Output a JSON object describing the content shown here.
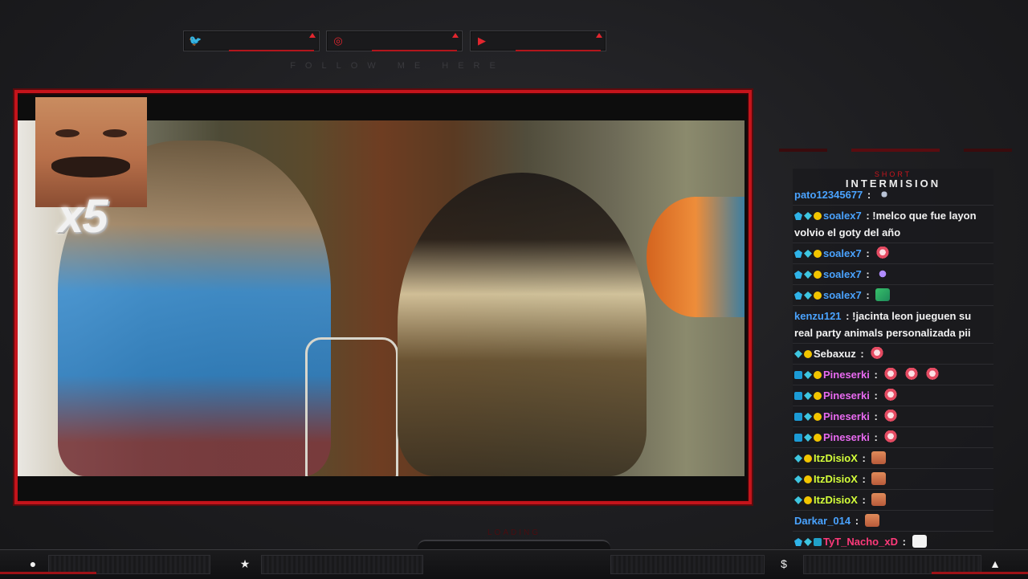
{
  "social": {
    "items": [
      {
        "icon": "twitter-icon",
        "glyph": "🐦"
      },
      {
        "icon": "instagram-icon",
        "glyph": "◎"
      },
      {
        "icon": "youtube-icon",
        "glyph": "▶"
      }
    ],
    "caption": "FOLLOW ME HERE"
  },
  "video_overlay": {
    "meme_multiplier": "x5"
  },
  "chat": {
    "subtitle": "SHORT",
    "title": "INTERMISION",
    "messages": [
      {
        "badges": [],
        "user": "pato12345677",
        "color": "#4aa3ff",
        "text": "",
        "emotes": [
          "em-mic"
        ]
      },
      {
        "badges": [
          "b-prime",
          "b-gem",
          "b-coin"
        ],
        "user": "soalex7",
        "color": "#4aa3ff",
        "text": "!melco que fue layon volvio el goty del año",
        "emotes": []
      },
      {
        "badges": [
          "b-prime",
          "b-gem",
          "b-coin"
        ],
        "user": "soalex7",
        "color": "#4aa3ff",
        "text": "",
        "emotes": [
          "em-pink"
        ]
      },
      {
        "badges": [
          "b-prime",
          "b-gem",
          "b-coin"
        ],
        "user": "soalex7",
        "color": "#4aa3ff",
        "text": "",
        "emotes": [
          "em-violet"
        ]
      },
      {
        "badges": [
          "b-prime",
          "b-gem",
          "b-coin"
        ],
        "user": "soalex7",
        "color": "#4aa3ff",
        "text": "",
        "emotes": [
          "em-green"
        ]
      },
      {
        "badges": [],
        "user": "kenzu121",
        "color": "#4aa3ff",
        "text": "!jacinta leon jueguen su real party animals personalizada pii",
        "emotes": []
      },
      {
        "badges": [
          "b-gem",
          "b-coin"
        ],
        "user": "Sebaxuz",
        "color": "#f2f2f2",
        "text": "",
        "emotes": [
          "em-pink"
        ]
      },
      {
        "badges": [
          "b-x",
          "b-gem",
          "b-coin"
        ],
        "user": "Pineserki",
        "color": "#e86af0",
        "text": "",
        "emotes": [
          "em-pink",
          "em-pink",
          "em-pink"
        ]
      },
      {
        "badges": [
          "b-x",
          "b-gem",
          "b-coin"
        ],
        "user": "Pineserki",
        "color": "#e86af0",
        "text": "",
        "emotes": [
          "em-pink"
        ]
      },
      {
        "badges": [
          "b-x",
          "b-gem",
          "b-coin"
        ],
        "user": "Pineserki",
        "color": "#e86af0",
        "text": "",
        "emotes": [
          "em-pink"
        ]
      },
      {
        "badges": [
          "b-x",
          "b-gem",
          "b-coin"
        ],
        "user": "Pineserki",
        "color": "#e86af0",
        "text": "",
        "emotes": [
          "em-pink"
        ]
      },
      {
        "badges": [
          "b-gem",
          "b-coin"
        ],
        "user": "ItzDisioX",
        "color": "#d4ff3a",
        "text": "",
        "emotes": [
          "em-face"
        ]
      },
      {
        "badges": [
          "b-gem",
          "b-coin"
        ],
        "user": "ItzDisioX",
        "color": "#d4ff3a",
        "text": "",
        "emotes": [
          "em-face"
        ]
      },
      {
        "badges": [
          "b-gem",
          "b-coin"
        ],
        "user": "ItzDisioX",
        "color": "#d4ff3a",
        "text": "",
        "emotes": [
          "em-face"
        ]
      },
      {
        "badges": [],
        "user": "Darkar_014",
        "color": "#4aa3ff",
        "text": "",
        "emotes": [
          "em-face"
        ]
      },
      {
        "badges": [
          "b-prime",
          "b-gem",
          "b-sq"
        ],
        "user": "TyT_Nacho_xD",
        "color": "#ff3a7a",
        "text": "",
        "emotes": [
          "em-white"
        ]
      }
    ]
  },
  "loading_label": "LOADING",
  "bottom_bar": {
    "icons": [
      {
        "name": "user-icon",
        "glyph": "●"
      },
      {
        "name": "star-icon",
        "glyph": "★"
      },
      {
        "name": "dollar-icon",
        "glyph": "$"
      },
      {
        "name": "rocket-icon",
        "glyph": "▲"
      }
    ]
  },
  "colors": {
    "accent": "#c4141b",
    "background": "#1e1e21"
  }
}
